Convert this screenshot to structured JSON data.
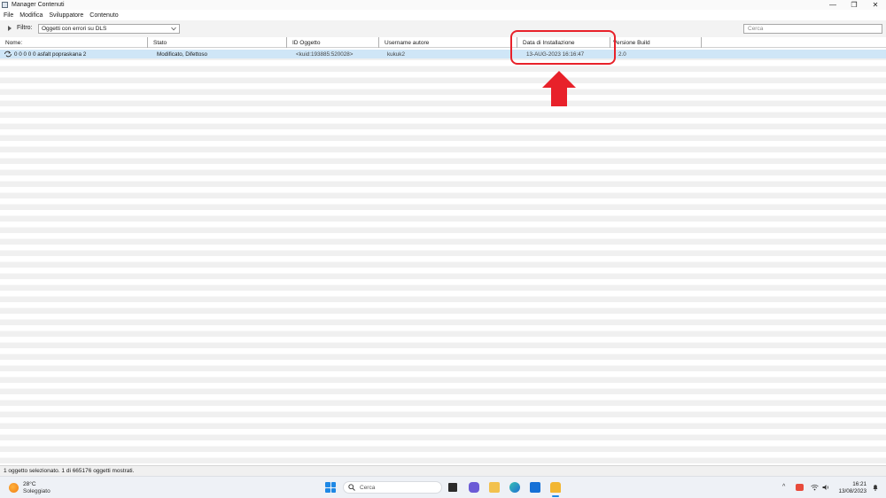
{
  "window": {
    "title": "Manager Contenuti",
    "controls": {
      "minimize": "—",
      "restore": "❐",
      "close": "✕"
    }
  },
  "menu": {
    "items": [
      "File",
      "Modifica",
      "Sviluppatore",
      "Contenuto"
    ]
  },
  "filter": {
    "label": "Filtro:",
    "selected": "Oggetti con errori su DLS"
  },
  "search": {
    "placeholder": "Cerca"
  },
  "table": {
    "columns": [
      "Nome:",
      "Stato",
      "ID Oggetto",
      "Username autore",
      "Data di Installazione",
      "Versione Build"
    ],
    "rows": [
      {
        "name": "0 0 0 0 0 asfalt popraskana 2",
        "status": "Modificato, Difettoso",
        "object_id": "<kuid:193885:520028>",
        "author": "kukuk2",
        "install_date": "13-AUG-2023 16:16:47",
        "build": "2.0",
        "selected": true
      }
    ]
  },
  "status": {
    "text": "1 oggetto selezionato. 1 di 665176 oggetti mostrati."
  },
  "taskbar": {
    "weather_temp": "28°C",
    "weather_desc": "Soleggiato",
    "search_placeholder": "Cerca",
    "time": "16:21",
    "date": "13/08/2023"
  },
  "colors": {
    "selection": "#cfe6f7",
    "annotation": "#e8212a",
    "accent": "#1e88e5"
  }
}
